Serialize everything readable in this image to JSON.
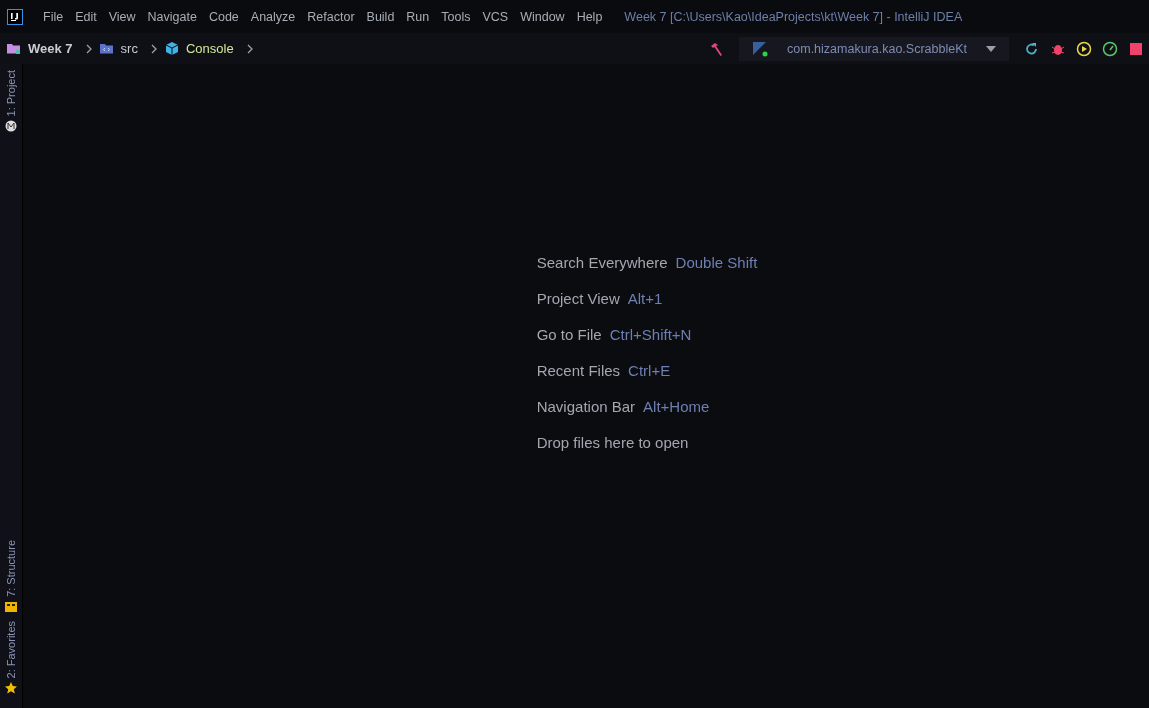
{
  "menu": [
    "File",
    "Edit",
    "View",
    "Navigate",
    "Code",
    "Analyze",
    "Refactor",
    "Build",
    "Run",
    "Tools",
    "VCS",
    "Window",
    "Help"
  ],
  "window": {
    "title": "Week 7 [C:\\Users\\Kao\\IdeaProjects\\kt\\Week 7] - IntelliJ IDEA"
  },
  "breadcrumbs": [
    {
      "label": "Week 7",
      "kind": "project"
    },
    {
      "label": "src",
      "kind": "folder"
    },
    {
      "label": "Console",
      "kind": "module"
    }
  ],
  "run_config": {
    "label": "com.hizamakura.kao.ScrabbleKt"
  },
  "tool_windows_top": [
    {
      "label": "1: Project",
      "kind": "project"
    }
  ],
  "tool_windows_bottom": [
    {
      "label": "7: Structure",
      "kind": "structure"
    },
    {
      "label": "2: Favorites",
      "kind": "favorites"
    }
  ],
  "hints": [
    {
      "action": "Search Everywhere",
      "shortcut": "Double Shift"
    },
    {
      "action": "Project View",
      "shortcut": "Alt+1"
    },
    {
      "action": "Go to File",
      "shortcut": "Ctrl+Shift+N"
    },
    {
      "action": "Recent Files",
      "shortcut": "Ctrl+E"
    },
    {
      "action": "Navigation Bar",
      "shortcut": "Alt+Home"
    },
    {
      "action": "Drop files here to open"
    }
  ]
}
